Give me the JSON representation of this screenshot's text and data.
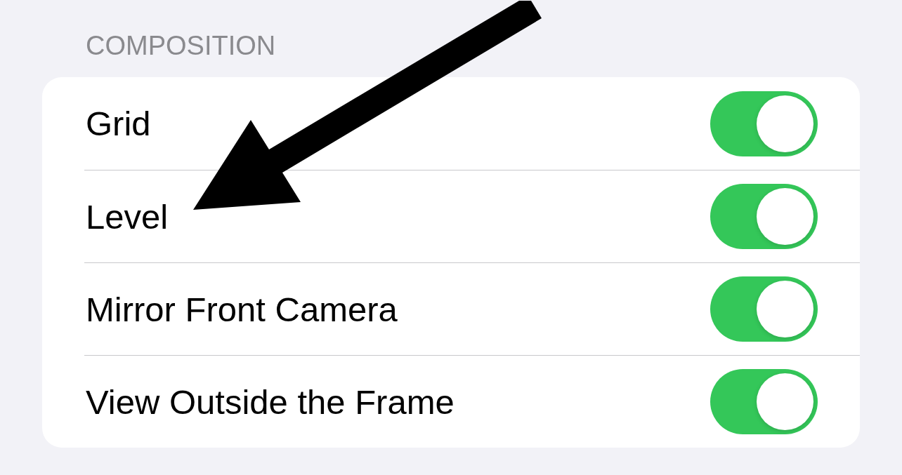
{
  "section": {
    "header": "COMPOSITION"
  },
  "rows": [
    {
      "label": "Grid",
      "kind": "toggle",
      "on": true,
      "pointed": false
    },
    {
      "label": "Level",
      "kind": "toggle",
      "on": true,
      "pointed": true
    },
    {
      "label": "Mirror Front Camera",
      "kind": "toggle",
      "on": true,
      "pointed": false
    },
    {
      "label": "View Outside the Frame",
      "kind": "toggle",
      "on": true,
      "pointed": false
    }
  ]
}
